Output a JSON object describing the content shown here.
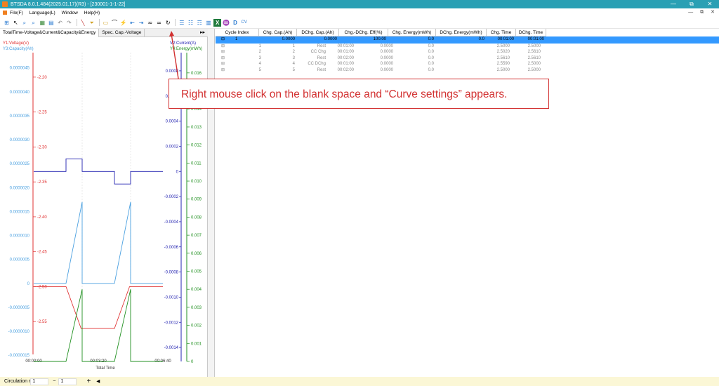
{
  "window": {
    "title": "BTSDA 8.0.1.484(2025.01.17)(R3) - [230001-1-1-22]",
    "controls": [
      "—",
      "⧉",
      "✕"
    ]
  },
  "menu": {
    "items": [
      "File(F)",
      "Language(L)",
      "Window",
      "Help(H)"
    ],
    "right_controls": [
      "—",
      "⧉",
      "✕"
    ]
  },
  "toolbar": {
    "icons": [
      "⊞",
      "↖",
      "⌕",
      "⌕",
      "▦",
      "▤",
      "↶",
      "↷",
      "╲",
      "⏷",
      "▭",
      "⌒",
      "⚡",
      "⇤",
      "⇥",
      "≂",
      "≃",
      "↻",
      "☰",
      "☷",
      "☶",
      "▥",
      "X",
      "♒",
      "D",
      "CV"
    ]
  },
  "left_panel": {
    "tabs": [
      "TotalTime-Voltage&Current&Capacity&Energy",
      "Spec. Cap.-Voltage"
    ],
    "tab_scroll": "▸▸"
  },
  "chart_data": {
    "type": "line",
    "xlabel": "Total Time",
    "x_ticks": [
      "00:00:00",
      "00:03:20",
      "00:06:40"
    ],
    "axes": {
      "y1": {
        "label": "Y1:Voltage(V)",
        "color": "#e03030",
        "ticks": [
          "-2.55",
          "-2.50",
          "-2.45",
          "-2.40",
          "-2.35",
          "-2.30",
          "-2.25",
          "-2.20"
        ]
      },
      "y3": {
        "label": "Y3:Capacity(Ah)",
        "color": "#4aa0e0",
        "ticks": [
          "0.0000045",
          "0.0000040",
          "0.0000035",
          "0.0000030",
          "0.0000025",
          "0.0000020",
          "0.0000015",
          "0.0000010",
          "0.0000005",
          "0",
          "-0.0000005",
          "-0.0000010",
          "-0.0000015"
        ]
      },
      "y2": {
        "label": "V2:Current(A)",
        "color": "#2020b0",
        "ticks": [
          "0.0008",
          "0.0006",
          "0.0004",
          "0.0002",
          "0",
          "-0.0002",
          "-0.0004",
          "-0.0006",
          "-0.0008",
          "-0.0010",
          "-0.0012",
          "-0.0014"
        ]
      },
      "y4": {
        "label": "Y4:Energy(mWh)",
        "color": "#209020",
        "ticks": [
          "0.016",
          "0.015",
          "0.014",
          "0.013",
          "0.012",
          "0.011",
          "0.010",
          "0.009",
          "0.008",
          "0.007",
          "0.006",
          "0.005",
          "0.004",
          "0.003",
          "0.002",
          "0.001",
          "0"
        ]
      }
    },
    "series": [
      {
        "axis": "y1",
        "color": "#e03030",
        "x": [
          0,
          60,
          88,
          150,
          178,
          240
        ],
        "y": [
          -2.5,
          -2.5,
          -2.56,
          -2.56,
          -2.5,
          -2.5
        ]
      },
      {
        "axis": "y2",
        "color": "#2020b0",
        "x": [
          0,
          60,
          60,
          90,
          90,
          150,
          150,
          180,
          180,
          240
        ],
        "y": [
          0,
          0,
          0.0001,
          0.0001,
          0,
          0,
          -0.0001,
          -0.0001,
          0,
          0
        ]
      },
      {
        "axis": "y3",
        "color": "#4aa0e0",
        "x": [
          0,
          60,
          90,
          90,
          150,
          180,
          180,
          240
        ],
        "y": [
          0,
          0,
          1.7e-06,
          0,
          0,
          1.7e-06,
          0,
          0
        ]
      },
      {
        "axis": "y4",
        "color": "#209020",
        "x": [
          0,
          60,
          90,
          90,
          150,
          180,
          180,
          240
        ],
        "y": [
          0,
          0,
          0.004,
          0,
          0,
          0.004,
          0,
          0
        ]
      }
    ]
  },
  "table": {
    "columns": [
      "Cycle Index",
      "Chg. Cap.(Ah)",
      "DChg. Cap.(Ah)",
      "Chg.-DChg. Eff(%)",
      "Chg. Energy(mWh)",
      "DChg. Energy(mWh)",
      "Chg. Time",
      "DChg. Time"
    ],
    "selected_row": [
      "1",
      "0.0000",
      "0.0000",
      "100.00",
      "0.0",
      "0.0",
      "00:01:00",
      "00:01:00"
    ],
    "rows": [
      [
        "1",
        "1",
        "Rest",
        "00:01:00",
        "0.0000",
        "0.0",
        "2.5000",
        "2.5000"
      ],
      [
        "2",
        "2",
        "CC Chg",
        "00:01:00",
        "0.0000",
        "0.0",
        "2.5020",
        "2.5610"
      ],
      [
        "3",
        "3",
        "Rest",
        "00:02:00",
        "0.0000",
        "0.0",
        "2.5610",
        "2.5610"
      ],
      [
        "4",
        "4",
        "CC DChg",
        "00:01:00",
        "0.0000",
        "0.0",
        "2.5590",
        "2.5000"
      ],
      [
        "5",
        "5",
        "Rest",
        "00:02:00",
        "0.0000",
        "0.0",
        "2.5000",
        "2.5000"
      ]
    ]
  },
  "callout": {
    "text": "Right mouse click on the blank space and “Curve settings” appears."
  },
  "statusbar": {
    "label": "Circulation r",
    "from_value": "1",
    "sep": "~",
    "to_value": "1",
    "add": "+",
    "nav": "◂"
  }
}
